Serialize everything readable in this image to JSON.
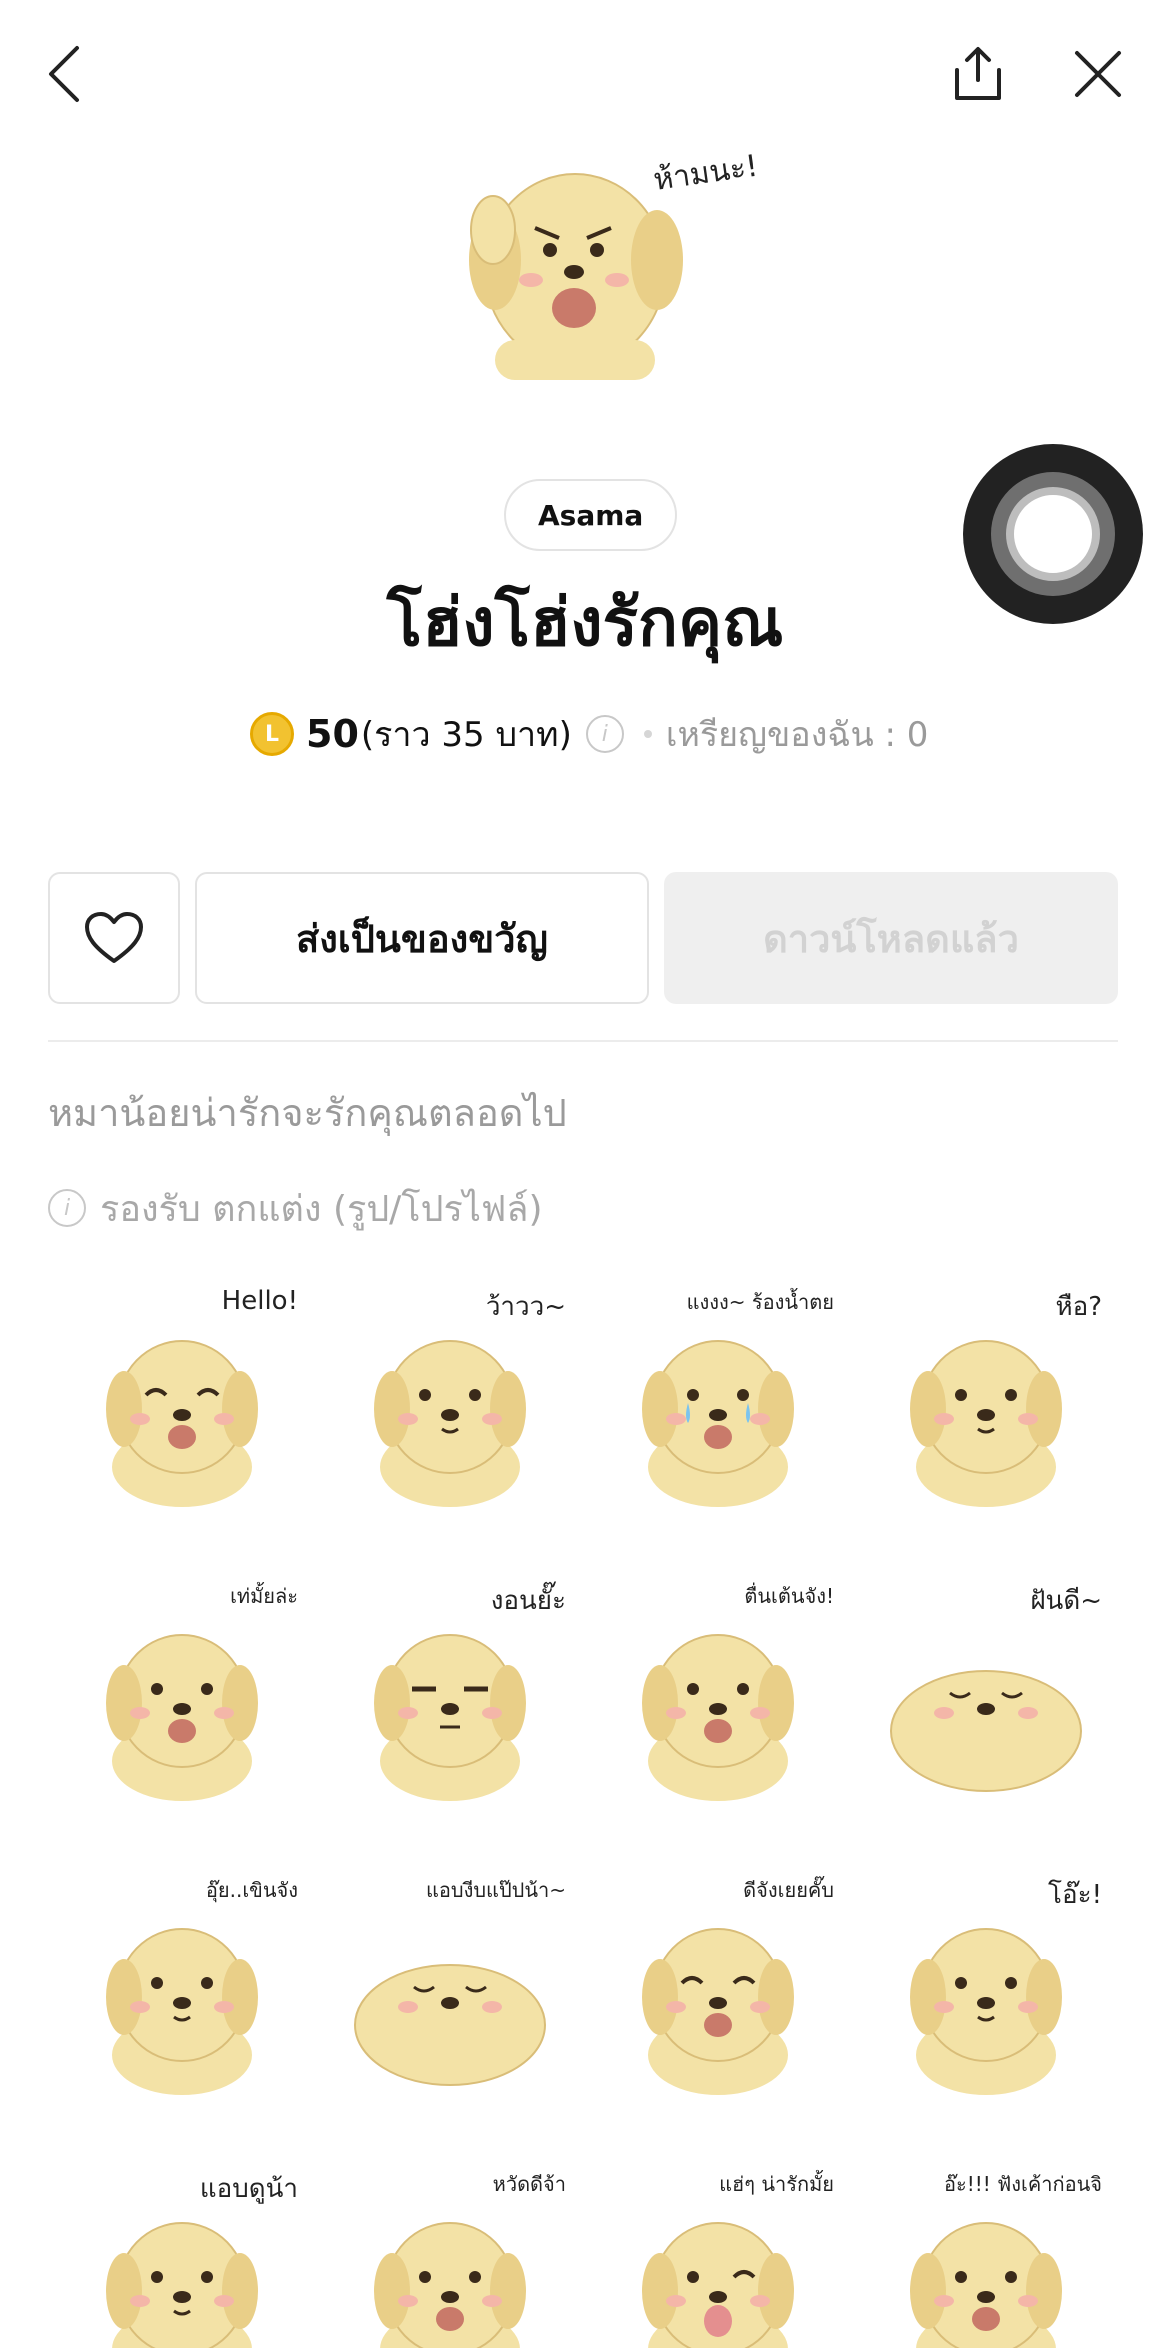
{
  "author": "Asama",
  "title": "โฮ่งโฮ่งรักคุณ",
  "price": {
    "coin_letter": "L",
    "amount": "50",
    "approx": "(ราว 35 บาท)",
    "info_glyph": "i",
    "my_coins": "เหรียญของฉัน : 0"
  },
  "actions": {
    "gift_label": "ส่งเป็นของขวัญ",
    "download_label": "ดาวน์โหลดแล้ว"
  },
  "description": "หมาน้อยน่ารักจะรักคุณตลอดไป",
  "support_note": "รองรับ ตกแต่ง (รูป/โปรไฟล์)",
  "hero_caption": "ห้ามนะ!",
  "stickers": [
    {
      "caption": "Hello!"
    },
    {
      "caption": "ว้าวว~"
    },
    {
      "caption": "แงงง~ ร้องน้ำตย"
    },
    {
      "caption": "หือ?"
    },
    {
      "caption": "เท่มั้ยล่ะ"
    },
    {
      "caption": "งอนยั๊ะ"
    },
    {
      "caption": "ตื่นเต้นจัง!"
    },
    {
      "caption": "ฝันดี~"
    },
    {
      "caption": "อุ๊ย..เขินจัง"
    },
    {
      "caption": "แอบงีบแป๊ปน้า~"
    },
    {
      "caption": "ดีจังเยยคั๊บ"
    },
    {
      "caption": "โอ๊ะ!"
    },
    {
      "caption": "แอบดูน้า"
    },
    {
      "caption": "หวัดดีจ้า"
    },
    {
      "caption": "แฮ่ๆ น่ารักมั้ย"
    },
    {
      "caption": "อ๊ะ!!! ฟังเค้าก่อนจิ"
    }
  ],
  "colors": {
    "fur": "#f3e2a6",
    "fur_shadow": "#e3c67c",
    "coin": "#f2c230",
    "muted_text": "#9a9a9a"
  }
}
